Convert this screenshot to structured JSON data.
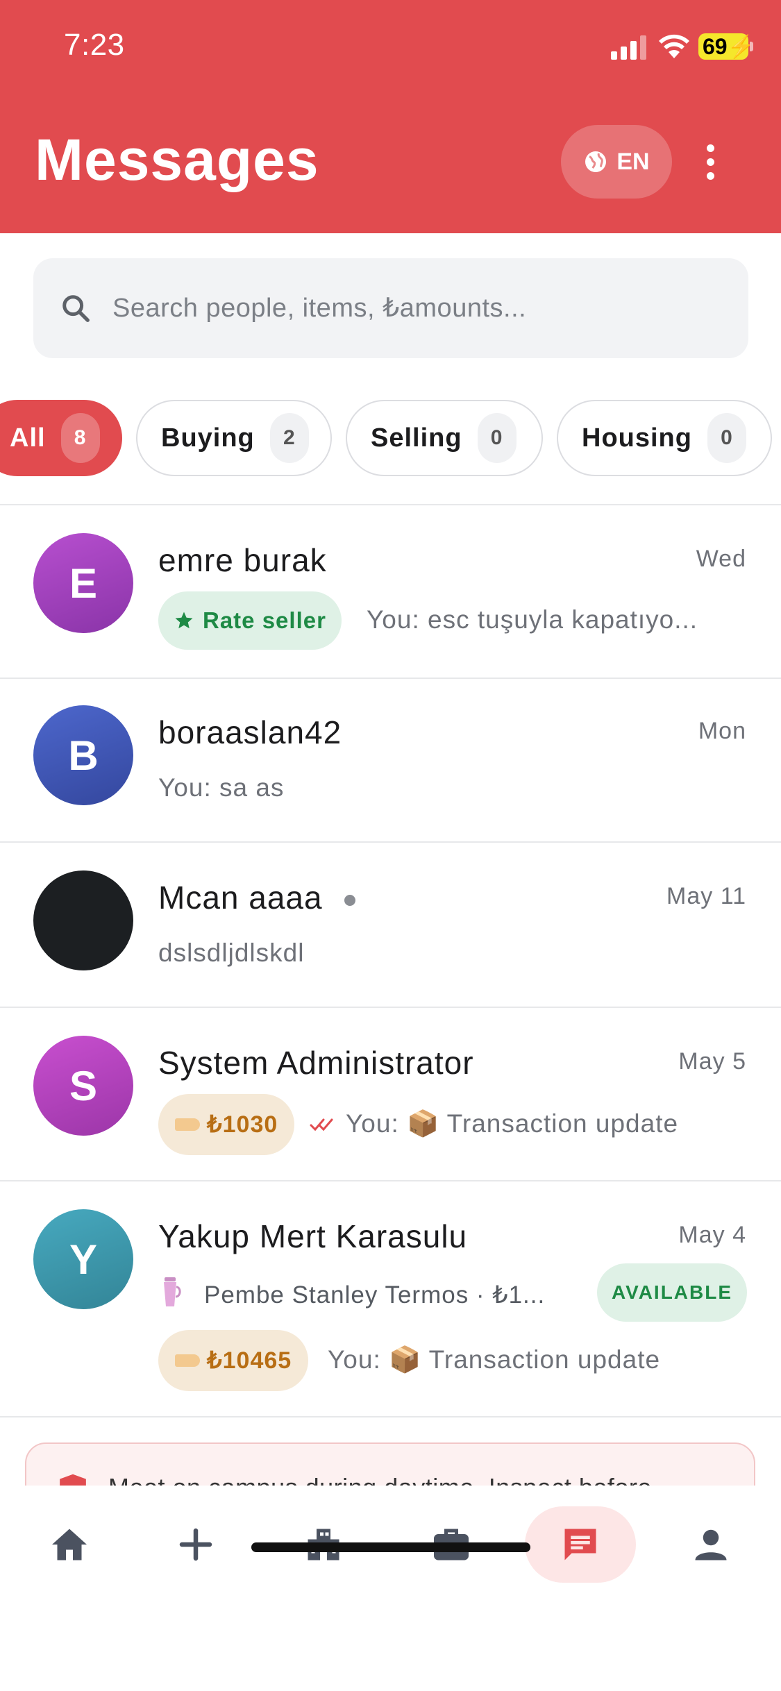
{
  "status_bar": {
    "time": "7:23",
    "battery": "69"
  },
  "header": {
    "title": "Messages",
    "language": "EN"
  },
  "search": {
    "placeholder": "Search people, items, ₺amounts..."
  },
  "filters": [
    {
      "label": "All",
      "count": "8",
      "active": true
    },
    {
      "label": "Buying",
      "count": "2",
      "active": false
    },
    {
      "label": "Selling",
      "count": "0",
      "active": false
    },
    {
      "label": "Housing",
      "count": "0",
      "active": false
    }
  ],
  "conversations": [
    {
      "initial": "E",
      "name": "emre burak",
      "time": "Wed",
      "badge": "Rate seller",
      "preview": "You: esc tuşuyla kapatıyo...",
      "avatar_color": "#a63fc0"
    },
    {
      "initial": "B",
      "name": "boraaslan42",
      "time": "Mon",
      "preview": "You: sa as",
      "avatar_color": "#3f58b8"
    },
    {
      "initial": "",
      "name": "Mcan aaaa",
      "time": "May 11",
      "preview": "dslsdljdlskdl",
      "avatar_color": "#1c1f22"
    },
    {
      "initial": "S",
      "name": "System Administrator",
      "time": "May 5",
      "price": "₺1030",
      "preview": "You: 📦 Transaction update",
      "avatar_color": "#b443bf"
    },
    {
      "initial": "Y",
      "name": "Yakup Mert Karasulu",
      "time": "May 4",
      "item": "Pembe Stanley Termos · ₺1...",
      "item_status": "AVAILABLE",
      "price": "₺10465",
      "preview": "You: 📦 Transaction update",
      "avatar_color": "#3b9bb0"
    }
  ],
  "safety_banner": {
    "text": "Meet on campus during daytime. Inspect before"
  },
  "bottom_nav": [
    {
      "icon": "home-icon"
    },
    {
      "icon": "plus-icon"
    },
    {
      "icon": "building-icon"
    },
    {
      "icon": "briefcase-icon"
    },
    {
      "icon": "chat-icon",
      "active": true
    },
    {
      "icon": "person-icon"
    }
  ],
  "colors": {
    "primary": "#e14b4f",
    "success": "#1e8a45",
    "price": "#b86e14"
  }
}
